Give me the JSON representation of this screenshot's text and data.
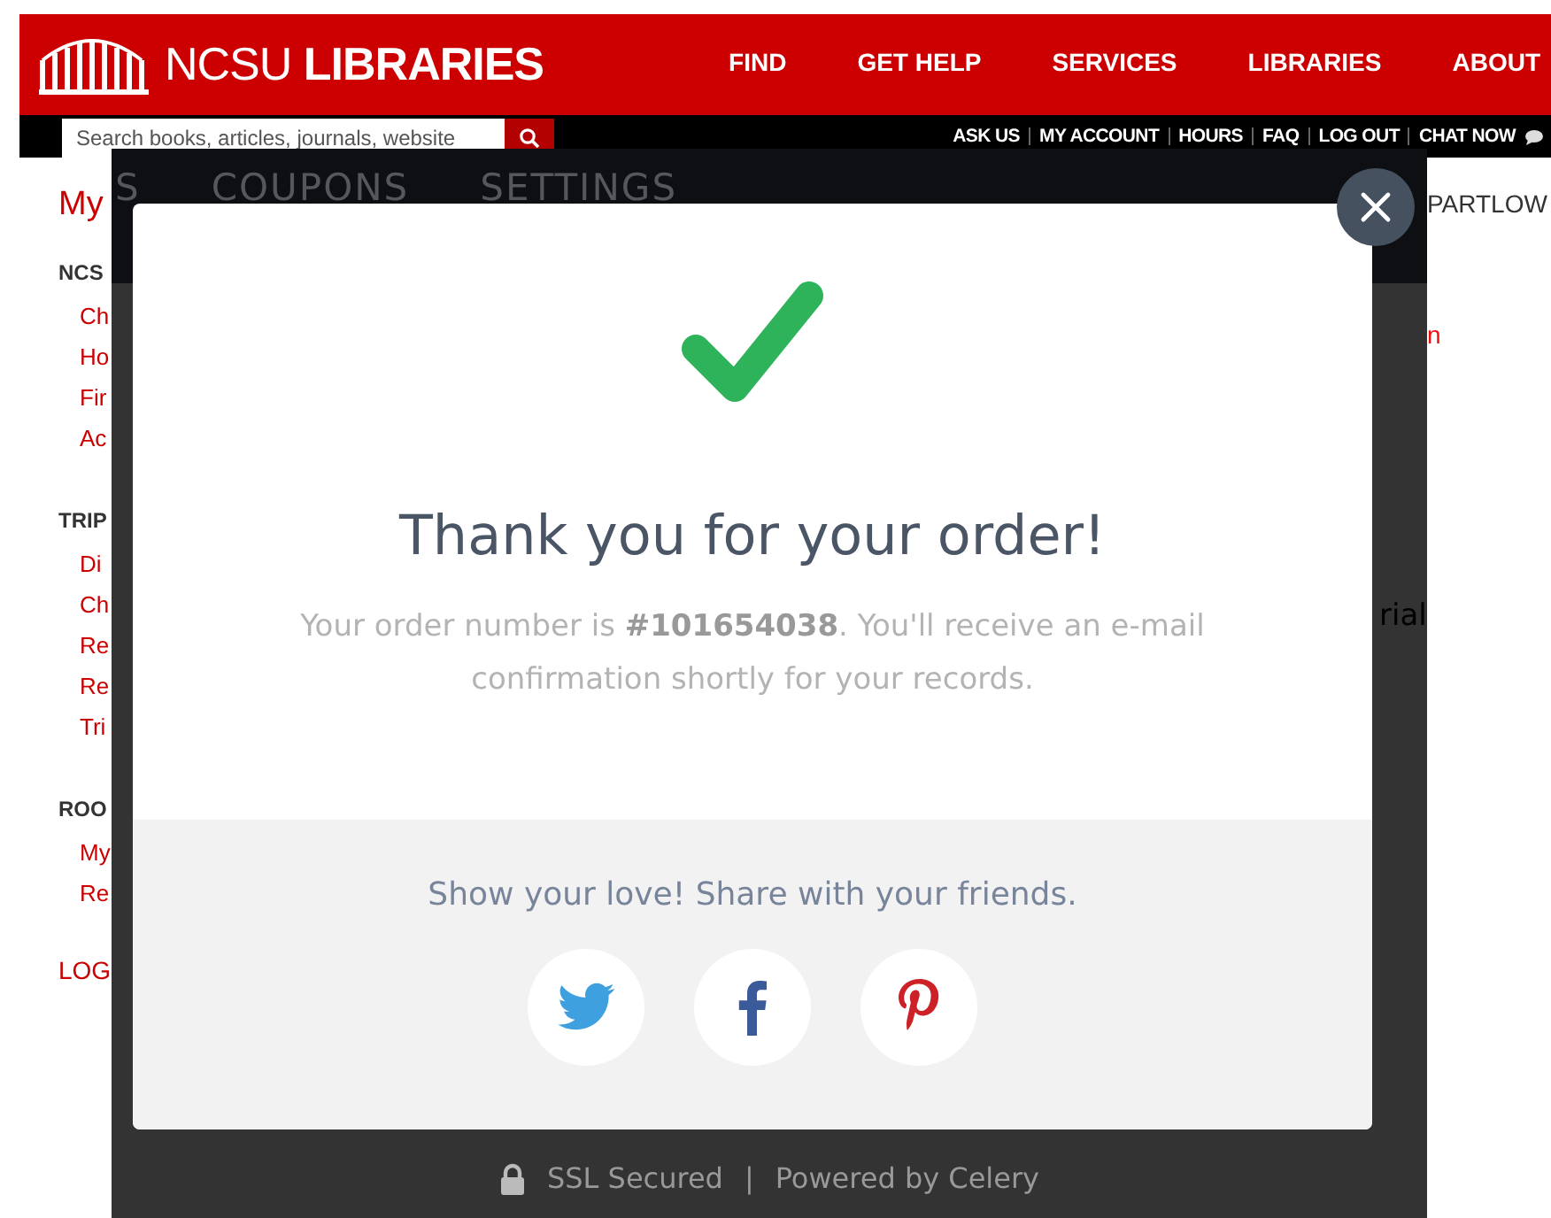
{
  "header": {
    "logo": "NCSU **LIBRARIES**",
    "nav": [
      "FIND",
      "GET HELP",
      "SERVICES",
      "LIBRARIES",
      "ABOUT"
    ]
  },
  "utility_bar": {
    "search": {
      "placeholder": "Search books, articles, journals, website"
    },
    "links": [
      "ASK US",
      "MY ACCOUNT",
      "HOURS",
      "FAQ",
      "LOG OUT",
      "CHAT NOW"
    ]
  },
  "sidebar": {
    "title": "My",
    "sections": [
      {
        "heading": "NCS",
        "items": [
          "Ch",
          "Ho",
          "Fir",
          "Ac"
        ]
      },
      {
        "heading": "TRIP",
        "items": [
          "Di",
          "Ch",
          "Re",
          "Re",
          "Tri"
        ]
      },
      {
        "heading": "ROO",
        "items": [
          "My",
          "Re"
        ]
      }
    ],
    "footer_link": "LOG"
  },
  "right_column": {
    "user": "PARTLOW",
    "link": "n"
  },
  "overlay": {
    "tabs": [
      "S",
      "COUPONS",
      "SETTINGS"
    ],
    "background_text": "rial",
    "modal": {
      "title": "Thank you for your order!",
      "message": "Your order number is **#101654038**. You'll receive an e-mail confirmation shortly for your records.",
      "share_prompt": "Show your love! Share with your friends.",
      "share_buttons": [
        {
          "kind": "bird"
        },
        {
          "kind": "f"
        },
        {
          "kind": "p"
        }
      ]
    },
    "footer": {
      "secure": "SSL Secured",
      "separator": "|",
      "powered": "Powered by Celery"
    }
  }
}
